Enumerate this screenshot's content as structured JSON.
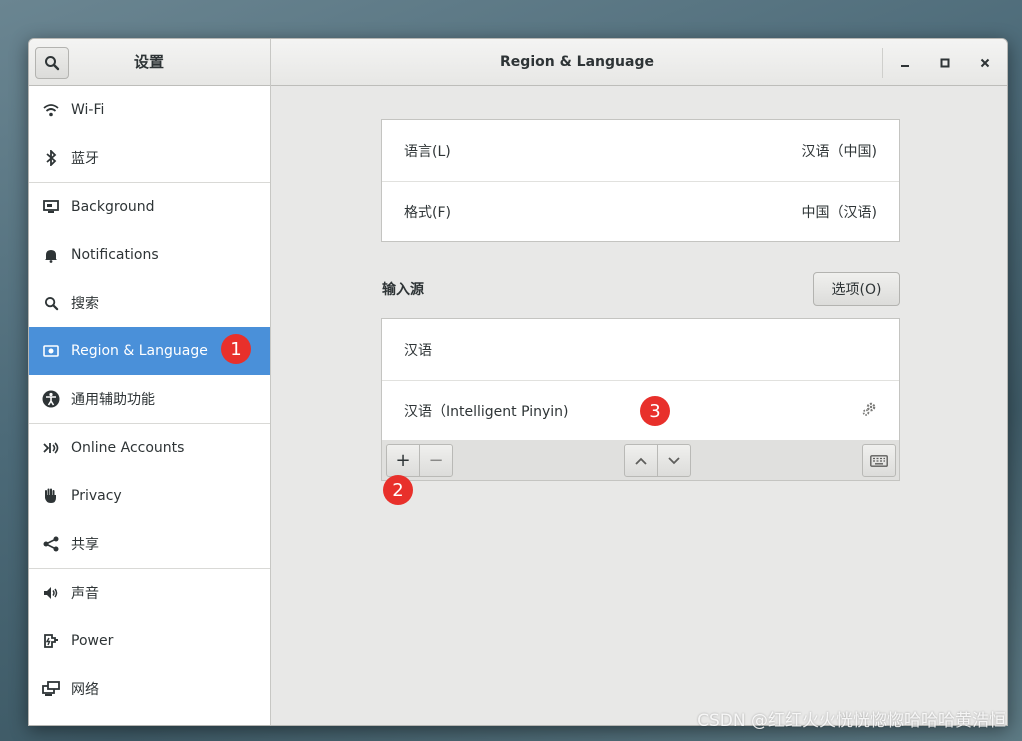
{
  "window": {
    "sidebar_title": "设置",
    "title": "Region & Language",
    "controls": {
      "minimize": "–",
      "maximize": "□",
      "close": "✕"
    }
  },
  "sidebar": {
    "items": [
      {
        "label": "Wi-Fi",
        "icon": "wifi-icon"
      },
      {
        "label": "蓝牙",
        "icon": "bluetooth-icon"
      },
      {
        "label": "Background",
        "icon": "background-icon"
      },
      {
        "label": "Notifications",
        "icon": "bell-icon"
      },
      {
        "label": "搜索",
        "icon": "search-icon"
      },
      {
        "label": "Region & Language",
        "icon": "region-icon",
        "active": true
      },
      {
        "label": "通用辅助功能",
        "icon": "accessibility-icon"
      },
      {
        "label": "Online Accounts",
        "icon": "online-accounts-icon"
      },
      {
        "label": "Privacy",
        "icon": "privacy-hand-icon"
      },
      {
        "label": "共享",
        "icon": "share-icon"
      },
      {
        "label": "声音",
        "icon": "speaker-icon"
      },
      {
        "label": "Power",
        "icon": "power-plug-icon"
      },
      {
        "label": "网络",
        "icon": "network-icon"
      }
    ],
    "accent": "#4a90d9"
  },
  "language_panel": {
    "language_label": "语言(L)",
    "language_value": "汉语（中国)",
    "format_label": "格式(F)",
    "format_value": "中国（汉语)"
  },
  "input_sources": {
    "heading": "输入源",
    "options_button": "选项(O)",
    "sources": [
      {
        "label": "汉语"
      },
      {
        "label": "汉语（Intelligent Pinyin)"
      }
    ],
    "add_label": "+",
    "remove_label": "−"
  },
  "annotations": [
    "1",
    "2",
    "3"
  ],
  "watermark": "CSDN @红红火火恍恍惚惚哈哈哈黄浩恒"
}
